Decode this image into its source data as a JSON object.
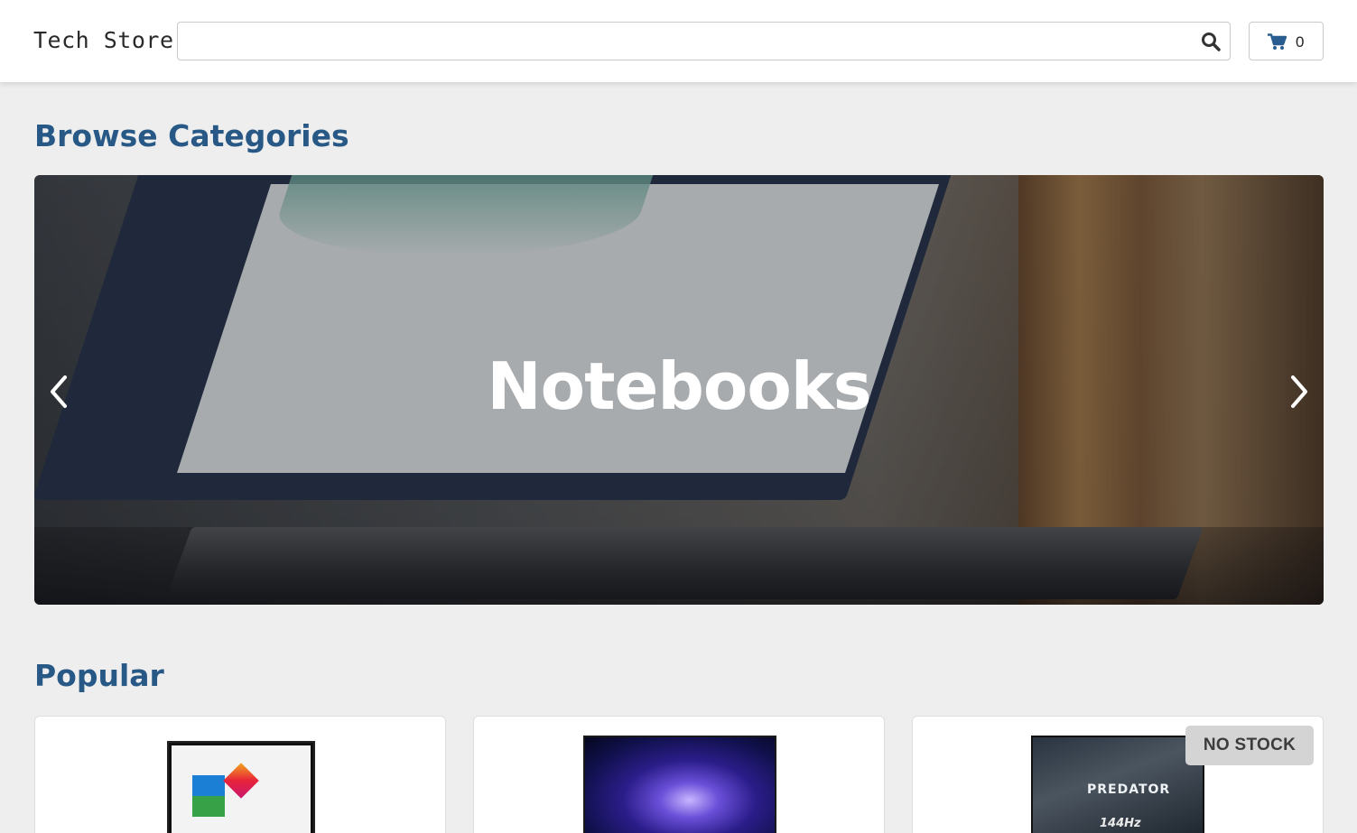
{
  "header": {
    "brand": "Tech Store",
    "search": {
      "value": "",
      "placeholder": ""
    },
    "cart_count": "0"
  },
  "sections": {
    "browse_title": "Browse Categories",
    "popular_title": "Popular"
  },
  "carousel": {
    "current_label": "Notebooks"
  },
  "products": [
    {
      "image": "omen-laptop",
      "badge": ""
    },
    {
      "image": "msi-laptop",
      "badge": ""
    },
    {
      "image": "predator-laptop",
      "badge": "NO STOCK",
      "image_text": {
        "brand": "PREDATOR",
        "refresh": "144Hz"
      }
    }
  ],
  "icons": {
    "search": "search-icon",
    "cart": "cart-icon",
    "prev": "chevron-left-icon",
    "next": "chevron-right-icon"
  },
  "colors": {
    "heading": "#275886",
    "badge_bg": "#d4d4d4",
    "page_bg": "#eeeeee"
  }
}
